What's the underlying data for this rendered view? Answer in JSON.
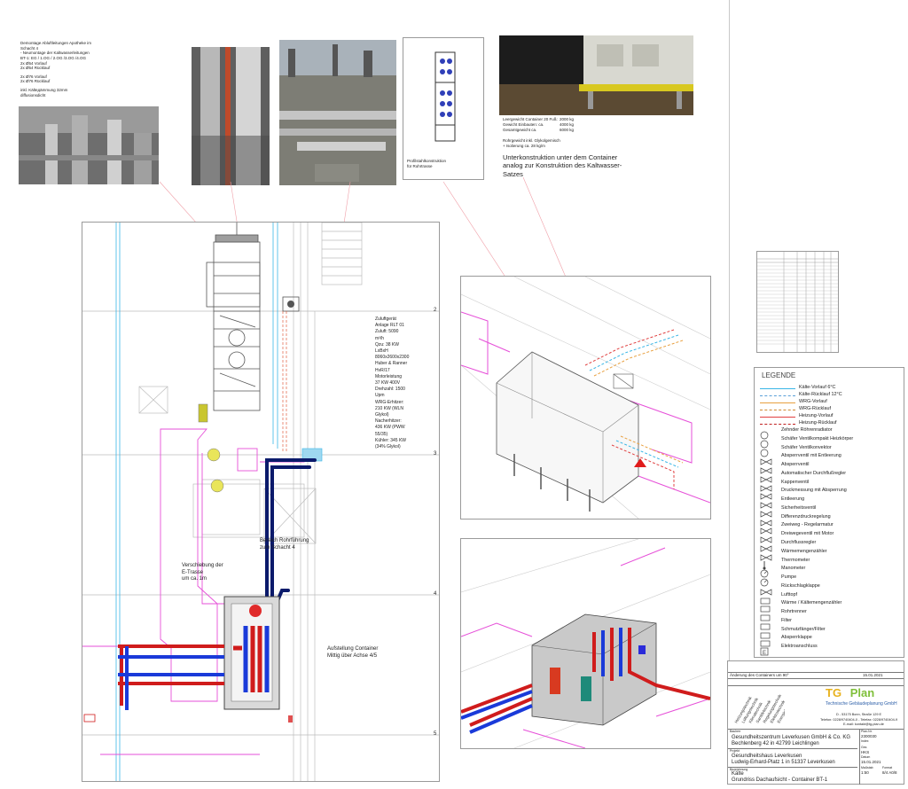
{
  "top_notes": {
    "demontage": [
      "Demontage Abluftleitungen Apotheke im",
      "Schacht 4",
      "- Neumontage der Kaltwasserleitungen",
      "BT-1: EG / 1.OG / 2.OG /3.OG /4.OG",
      "2x Ø54 Vorlauf",
      "2x Ø54 Rücklauf",
      "",
      "2x Ø76 Vorlauf",
      "2x Ø76 Rücklauf",
      "",
      "inkl. Kälteдämmung 32mm",
      "diffusionsdicht"
    ],
    "profile_caption": [
      "Profilstahlkonstruktion",
      "für Rohrtrasse"
    ],
    "weights": [
      {
        "label": "Leergewicht Container 20 Fuß:",
        "value": "2000 kg"
      },
      {
        "label": "Gewicht Einbauten: ca.",
        "value": "4000 kg"
      },
      {
        "label": "Gesamtgewicht ca.",
        "value": "6000 kg"
      }
    ],
    "rohr_note": [
      "Rohrgewicht inkl. Glykolgemisch",
      "+ Isolierung ca. 28 kg/m"
    ],
    "unterkonstruktion": [
      "Unterkonstruktion unter dem Container",
      "analog zur Konstruktion des Kaltwasser-",
      "Satzes"
    ]
  },
  "plan": {
    "rlt_label": [
      "Zuluftgerät",
      "Anlage RLT 01",
      "Zuluft: 5090",
      "m³/h",
      "Qzu: 38 KW",
      "LxBxH",
      "8060x2600x2300",
      "Huber & Ranner",
      "HvR/17",
      "Motorleistung",
      "37 KW 400V",
      "Drehzahl: 1500",
      "Upm",
      "WRG-Erhitzer:",
      "210 KW (WLN",
      "Glykol)",
      "Nacherhitzer:",
      "436 KW (PWW",
      "55/35)",
      "Kühler: 345 KW",
      "(34% Glykol)"
    ],
    "bereich": [
      "Bereich Rohrführung",
      "zum Schacht 4"
    ],
    "verschiebung": [
      "Verschiebung der",
      "E-Trasse",
      "um ca. 1m"
    ],
    "aufstellung": [
      "Aufstellung Container",
      "Mittig über Achse 4/5"
    ],
    "grid_numbers": [
      "2",
      "3",
      "4",
      "5"
    ]
  },
  "legend": {
    "title": "LEGENDE",
    "lines": [
      {
        "label": "Kälte-Vorlauf 6°C",
        "color": "#39b6e6"
      },
      {
        "label": "Kälte-Rücklauf 12°C",
        "color": "#5aa0d8"
      },
      {
        "label": "WRG-Vorlauf",
        "color": "#e8a040"
      },
      {
        "label": "WRG-Rücklauf",
        "color": "#d08a30"
      },
      {
        "label": "Heizung-Vorlauf",
        "color": "#e04040"
      },
      {
        "label": "Heizung-Rücklauf",
        "color": "#c02020"
      }
    ],
    "symbols": [
      {
        "label": "Zehnder Röhrenradiator",
        "icon": "circle-1-icon"
      },
      {
        "label": "Schäfer Ventilkompakt Heizkörper",
        "icon": "circle-2-icon"
      },
      {
        "label": "Schäfer Ventilkonvektor",
        "icon": "circle-3-icon"
      },
      {
        "label": "Absperrventil mit Entleerung",
        "icon": "valve-icon"
      },
      {
        "label": "Absperrventil",
        "icon": "valve-icon"
      },
      {
        "label": "Automatischer Durchflußregler",
        "icon": "valve-icon"
      },
      {
        "label": "Kappenventil",
        "icon": "valve-icon"
      },
      {
        "label": "Druckmessung mit Absperrung",
        "icon": "valve-icon"
      },
      {
        "label": "Entleerung",
        "icon": "valve-icon"
      },
      {
        "label": "Sicherheitsventil",
        "icon": "valve-icon"
      },
      {
        "label": "Differenzdruckregelung",
        "icon": "valve-icon"
      },
      {
        "label": "Zweiweg - Regelarmatur",
        "icon": "valve-icon"
      },
      {
        "label": "Dreiwegeventil mit Motor",
        "icon": "valve-icon"
      },
      {
        "label": "Durchflussregler",
        "icon": "valve-icon"
      },
      {
        "label": "Wärmemengenzähler",
        "icon": "valve-icon"
      },
      {
        "label": "Thermometer",
        "icon": "thermometer-icon"
      },
      {
        "label": "Manometer",
        "icon": "gauge-icon"
      },
      {
        "label": "Pumpe",
        "icon": "pump-icon"
      },
      {
        "label": "Rückschlagklappe",
        "icon": "valve-icon"
      },
      {
        "label": "Lufttopf",
        "icon": "box-icon"
      },
      {
        "label": "Wärme / Kältemengenzähler",
        "icon": "box-icon"
      },
      {
        "label": "Rohrtrenner",
        "icon": "box-icon"
      },
      {
        "label": "Filter",
        "icon": "box-icon"
      },
      {
        "label": "Schmutzfänger/Filter",
        "icon": "box-icon"
      },
      {
        "label": "Absperrklappe",
        "icon": "box-icon"
      },
      {
        "label": "Elektroanschluss",
        "icon": "e-box-icon"
      }
    ]
  },
  "title_block": {
    "company_name": "TG",
    "company_name2": "Plan",
    "company_sub": "Technische Gebäudeplanung GmbH",
    "services": [
      "Heizungstechnik",
      "Lüftungstechnik",
      "Klimatechnik",
      "Sanitärtechnik",
      "Regelungstechnik",
      "Elektrotechnik",
      "Energieberatung"
    ],
    "address": "D - 53175 Bonn, Straße 129 E",
    "contact": "Telefon: 0228/9740404-0 - Telefax: 0228/9740404-9",
    "email": "E-mail: kontakt@tg-plan.de",
    "bauherr_label": "Bauherr",
    "bauherr": "Gesundheitszentrum Leverkusen GmbH & Co. KG",
    "bauherr_addr": "Bechlenberg 42 in 42799 Leichlingen",
    "projekt_label": "Projekt",
    "projekt": "Gesundheitshaus Leverkusen",
    "projekt_addr": "Ludwig-Erhard-Platz 1 in 51337 Leverkusen",
    "bez_label": "Bezeichnung",
    "gewerk": "Kälte",
    "plan_title": "Grundriss Dachaufsicht - Container BT-1",
    "right_fields": [
      "Plan-Nr.",
      "2300030",
      "Index",
      "Gez.",
      "HKS",
      "Datum",
      "15.01.2021",
      "Maßstab",
      "1:50",
      "Format",
      "8/4 A0/8"
    ],
    "change_row": "Änderung des Containers um 90°",
    "date_small": "15.01.2021"
  }
}
